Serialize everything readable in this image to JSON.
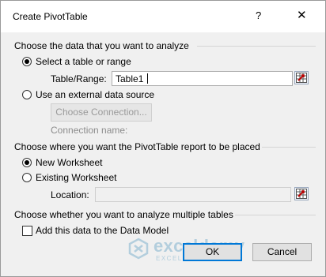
{
  "window": {
    "title": "Create PivotTable",
    "help_glyph": "?",
    "close_glyph": "✕"
  },
  "section1": {
    "heading": "Choose the data that you want to analyze",
    "option_table": "Select a table or range",
    "table_range_label": "Table/Range:",
    "table_range_value": "Table1",
    "option_external": "Use an external data source",
    "choose_connection_button": "Choose Connection...",
    "connection_name_label": "Connection name:"
  },
  "section2": {
    "heading": "Choose where you want the PivotTable report to be placed",
    "option_new": "New Worksheet",
    "option_existing": "Existing Worksheet",
    "location_label": "Location:",
    "location_value": ""
  },
  "section3": {
    "heading": "Choose whether you want to analyze multiple tables",
    "data_model_checkbox_label": "Add this data to the Data Model",
    "data_model_checked": false
  },
  "buttons": {
    "ok": "OK",
    "cancel": "Cancel"
  },
  "watermark": {
    "name": "exceldemy",
    "tagline": "EXCEL · DATA · BI"
  },
  "selection": {
    "data_source": "table_or_range",
    "placement": "new_worksheet"
  },
  "colors": {
    "default_button_border": "#0078d7",
    "watermark": "#6aa6c8"
  },
  "icons": [
    "help-icon",
    "close-icon",
    "collapse-dialog-icon",
    "exceldemy-logo-icon"
  ]
}
